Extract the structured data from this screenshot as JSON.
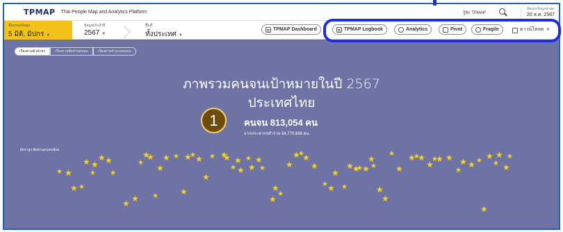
{
  "header": {
    "logo": "TPMAP",
    "subtitle": "Thai People Map and Analytics Platform",
    "about_link": "รู้จัก TPMAP",
    "updated_label": "อัพเดทข้อมูลล่าสุด",
    "updated_date": "20 ส.ค. 2567"
  },
  "filters": {
    "source_label": "ชื่อแหล่งข้อมูล",
    "source_value": "5 มิติ, มิปกร",
    "year_label": "ข้อมูลประจำปี",
    "year_value": "2567",
    "area_label": "พื้นที่",
    "area_value": "ทั้งประเทศ"
  },
  "toolbar": {
    "dashboard": "TPMAP Dashboard",
    "logbook": "TPMAP Logbook",
    "analytics": "Analytics",
    "pivot": "Pivot",
    "fragile": "Fragile",
    "download": "ดาวน์โหลด"
  },
  "tabs": [
    "เรียงตามตัวอักษร",
    "เรียงตามสัดส่วนคนจน",
    "เรียงตามจำนวนคนจน"
  ],
  "main": {
    "title_line1": "ภาพรวมคนจนเป้าหมายในปี 2567",
    "title_line2": "ประเทศไทย",
    "rank_badge": "1",
    "poor_count": "คนจน 813,054 คน",
    "from_total": "จากประชากรสำรวจ 34,770,696 คน",
    "axis_note": "อัตราสูง สัดส่วนคนจนน้อย"
  },
  "colors": {
    "accent_yellow": "#f4c21a",
    "background": "#6e72a4",
    "star": "#f6d22b",
    "highlight_box": "#1b2fe0",
    "badge_fill": "#6e4c0c"
  },
  "icons": [
    "search-icon",
    "dashboard-icon",
    "logbook-icon",
    "analytics-icon",
    "pivot-icon",
    "fragile-icon",
    "download-icon",
    "star-icon",
    "chevron-down-icon"
  ]
}
